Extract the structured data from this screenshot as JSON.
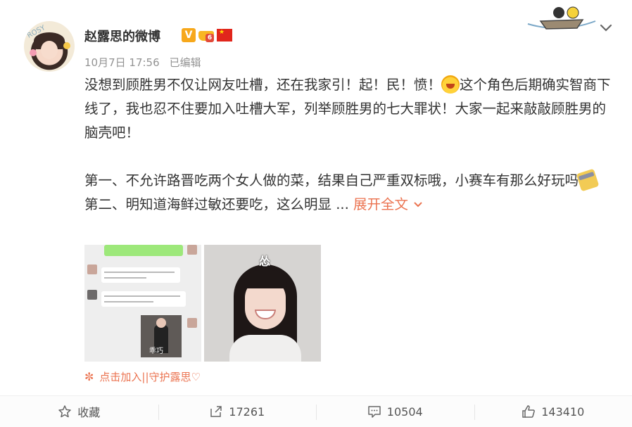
{
  "post": {
    "author": "赵露思的微博",
    "avatar_text": "ROSY",
    "badge_v": "V",
    "badge_level": "6",
    "timestamp": "10月7日 17:56",
    "edited": "已编辑",
    "content": {
      "para1_part1": "没想到顾胜男不仅让网友吐槽，还在我家引！起！民！愤！",
      "para1_part2": "这个角色后期确实智商下线了，我也忍不住要加入吐槽大军，列举顾胜男的七大罪状！大家一起来敲敲顾胜男的脑壳吧！",
      "item1": "第一、不允许路晋吃两个女人做的菜，结果自己严重双标哦，小赛车有那么好玩吗",
      "item2": "第二、明知道海鲜过敏还要吃，这么明显 ... ",
      "expand": "展开全文"
    },
    "images": {
      "photo_caption_1": "乖巧",
      "photo_caption_2": "怂"
    },
    "fan_link": "点击加入||守护露思♡"
  },
  "actions": {
    "favorite": "收藏",
    "repost": "17261",
    "comment": "10504",
    "like": "143410"
  },
  "colors": {
    "accent": "#eb7350",
    "text": "#333333",
    "meta": "#939393"
  }
}
